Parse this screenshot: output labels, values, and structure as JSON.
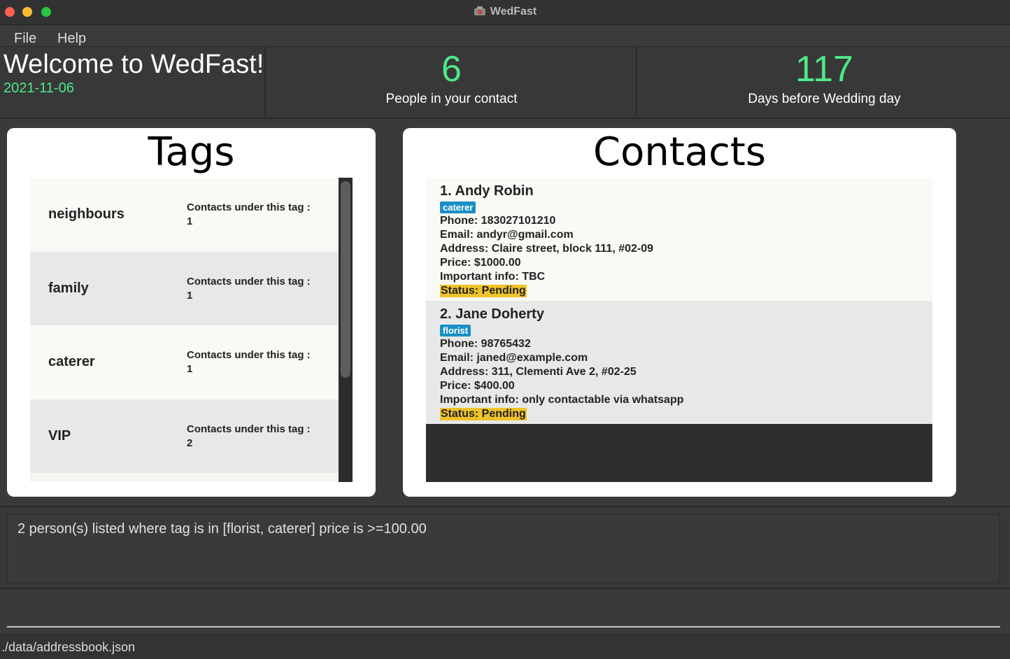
{
  "window": {
    "title": "WedFast",
    "icon": "app-icon"
  },
  "menu": {
    "file": "File",
    "help": "Help"
  },
  "header": {
    "welcome": "Welcome to WedFast!",
    "date": "2021-11-06",
    "people_count": "6",
    "people_label": "People in your contact",
    "days_count": "117",
    "days_label": "Days before Wedding day",
    "accent_color": "#4de98a"
  },
  "tags_panel": {
    "title": "Tags",
    "items": [
      {
        "name": "neighbours",
        "count_label": "Contacts under this tag :",
        "count": "1"
      },
      {
        "name": "family",
        "count_label": "Contacts under this tag :",
        "count": "1"
      },
      {
        "name": "caterer",
        "count_label": "Contacts under this tag :",
        "count": "1"
      },
      {
        "name": "VIP",
        "count_label": "Contacts under this tag :",
        "count": "2"
      }
    ]
  },
  "contacts_panel": {
    "title": "Contacts",
    "items": [
      {
        "name": "1.  Andy Robin",
        "tag": "caterer",
        "phone": "Phone: 183027101210",
        "email": "Email: andyr@gmail.com",
        "address": "Address: Claire street, block 111, #02-09",
        "price": "Price: $1000.00",
        "info": "Important info: TBC",
        "status": "Status: Pending"
      },
      {
        "name": "2.  Jane Doherty",
        "tag": "florist",
        "phone": "Phone: 98765432",
        "email": "Email: janed@example.com",
        "address": "Address: 311, Clementi Ave 2, #02-25",
        "price": "Price: $400.00",
        "info": "Important info: only contactable via whatsapp",
        "status": "Status: Pending"
      }
    ]
  },
  "result": {
    "text": "2 person(s) listed where tag is in [florist, caterer] price is >=100.00"
  },
  "command": {
    "value": ""
  },
  "statusbar": {
    "path": "./data/addressbook.json"
  }
}
